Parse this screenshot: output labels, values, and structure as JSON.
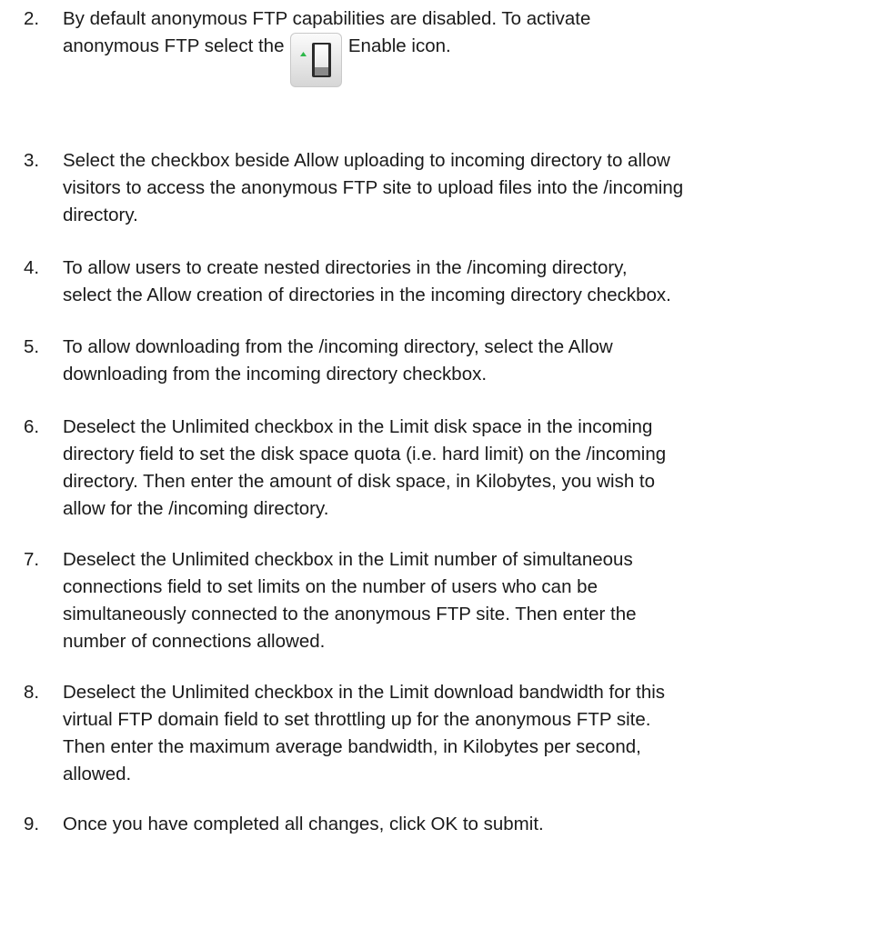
{
  "steps": [
    {
      "number": "2.",
      "lines": [
        "By default anonymous FTP capabilities are disabled. To activate",
        "anonymous FTP select the",
        "Enable icon."
      ],
      "icon": "enable-toggle-icon"
    },
    {
      "number": "3.",
      "lines": [
        "Select the checkbox beside Allow uploading to incoming directory to allow",
        "visitors to access the anonymous FTP site to upload files into the /incoming",
        "directory."
      ]
    },
    {
      "number": "4.",
      "lines": [
        "To allow users to create nested directories in the /incoming directory,",
        "select the Allow creation of directories in the incoming directory checkbox."
      ]
    },
    {
      "number": "5.",
      "lines": [
        "To allow downloading from the /incoming directory, select the Allow",
        "downloading from the incoming directory checkbox."
      ]
    },
    {
      "number": "6.",
      "lines": [
        "Deselect the Unlimited checkbox in the Limit disk space in the incoming",
        "directory field to set the disk space quota (i.e. hard limit) on the /incoming",
        "directory. Then enter the amount of disk space, in Kilobytes, you wish to",
        "allow for the /incoming directory."
      ]
    },
    {
      "number": "7.",
      "lines": [
        "Deselect the Unlimited checkbox in the Limit number of simultaneous",
        "connections field to set limits on the number of users who can be",
        "simultaneously connected to the anonymous FTP site. Then enter the",
        "number of connections allowed."
      ]
    },
    {
      "number": "8.",
      "lines": [
        "Deselect the Unlimited checkbox in the Limit download bandwidth for this",
        "virtual FTP domain field to set throttling up for the anonymous FTP site.",
        "Then enter the maximum average bandwidth, in Kilobytes per second,",
        "allowed."
      ]
    },
    {
      "number": "9.",
      "lines": [
        "Once you have completed all changes, click OK to submit."
      ]
    }
  ],
  "colors": {
    "text": "#1a1a1a",
    "icon_arrow": "#2db84a"
  }
}
